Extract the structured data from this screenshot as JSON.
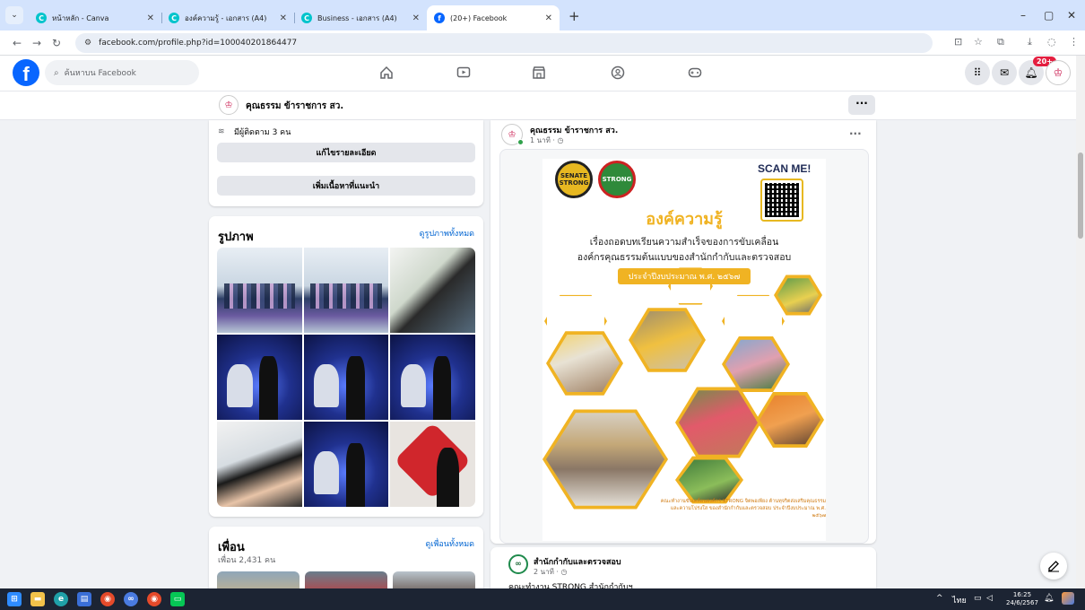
{
  "browser": {
    "tabs": [
      {
        "title": "หน้าหลัก - Canva",
        "fav_color": "#00c4cc",
        "active": false
      },
      {
        "title": "องค์ความรู้ - เอกสาร (A4)",
        "fav_color": "#00c4cc",
        "active": false
      },
      {
        "title": "Business - เอกสาร (A4)",
        "fav_color": "#00c4cc",
        "active": false
      },
      {
        "title": "(20+) Facebook",
        "fav_color": "#0866ff",
        "active": true
      }
    ],
    "url": "facebook.com/profile.php?id=100040201864477"
  },
  "fb": {
    "search_placeholder": "ค้นหาบน Facebook",
    "notif_badge": "20+",
    "brand_color": "#0866ff"
  },
  "profile": {
    "name": "คุณธรรม ข้าราชการ สว.",
    "followers": "มีผู้ติดตาม 3 คน",
    "edit_details": "แก้ไขรายละเอียด",
    "add_featured": "เพิ่มเนื้อหาที่แนะนำ"
  },
  "photos": {
    "title": "รูปภาพ",
    "see_all": "ดูรูปภาพทั้งหมด",
    "items": [
      "group-photo",
      "group-photo",
      "booth-photo",
      "robot-photo",
      "robot-photo",
      "robot-photo",
      "selfie-photo",
      "robot-photo",
      "heart-photo"
    ]
  },
  "friends": {
    "title": "เพื่อน",
    "count": "เพื่อน 2,431 คน",
    "see_all": "ดูเพื่อนทั้งหมด"
  },
  "post1": {
    "author": "คุณธรรม ข้าราชการ สว.",
    "time": "1 นาที · ◷",
    "image": {
      "logo_a": "SENATE STRONG",
      "logo_b": "STRONG",
      "scan": "SCAN ME!",
      "title": "องค์ความรู้",
      "line1": "เรื่องถอดบทเรียนความสำเร็จของการขับเคลื่อน",
      "line2": "องค์กรคุณธรรมต้นแบบของสำนักกำกับและตรวจสอบ",
      "pill": "ประจำปีงบประมาณ พ.ศ. ๒๕๖๗",
      "footer": "คณะทำงานขับเคลื่อนองค์กร STRONG จิตพอเพียง ต้านทุจริตส่งเสริมคุณธรรม และความโปร่งใส ของสำนักกำกับและตรวจสอบ ประจำปีงบประมาณ พ.ศ. ๒๕๖๗"
    }
  },
  "post2": {
    "author": "สำนักกำกับและตรวจสอบ",
    "time": "2 นาที · ◷",
    "text": "คณะทำงาน STRONG สำนักกำกับฯ"
  },
  "taskbar": {
    "lang": "ไทย",
    "time": "16:25",
    "date": "24/6/2567"
  }
}
